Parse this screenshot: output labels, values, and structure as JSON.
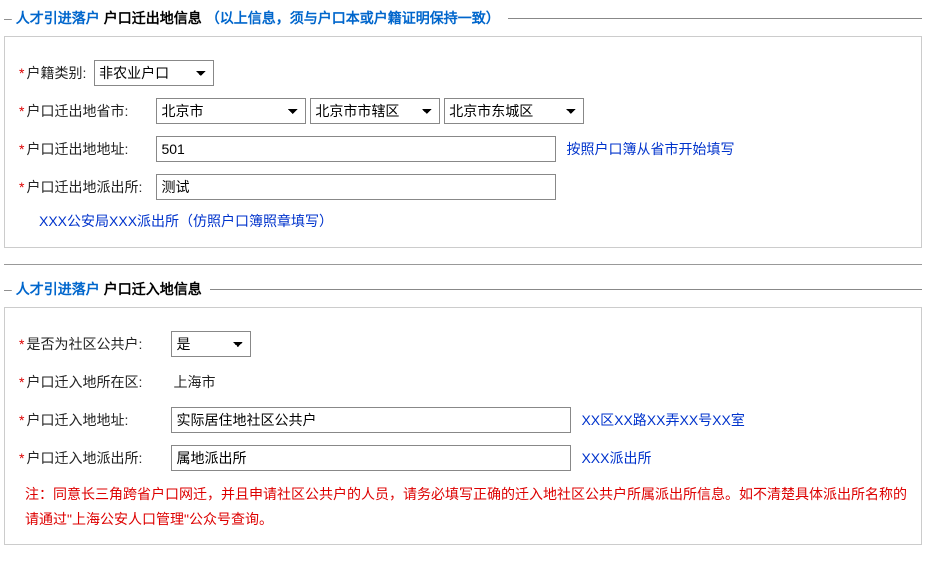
{
  "section1": {
    "title_blue": "人才引进落户",
    "title_black": "户口迁出地信息",
    "title_note": "（以上信息，须与户口本或户籍证明保持一致）",
    "hukou_type": {
      "label": "户籍类别:",
      "value": "非农业户口"
    },
    "province_row": {
      "label": "户口迁出地省市:",
      "province": "北京市",
      "city": "北京市市辖区",
      "district": "北京市东城区"
    },
    "addr": {
      "label": "户口迁出地地址:",
      "value": "501",
      "hint": "按照户口簿从省市开始填写"
    },
    "police": {
      "label": "户口迁出地派出所:",
      "value": "测试"
    },
    "police_hint": "XXX公安局XXX派出所（仿照户口簿照章填写）"
  },
  "section2": {
    "title_blue": "人才引进落户",
    "title_black": "户口迁入地信息",
    "community": {
      "label": "是否为社区公共户:",
      "value": "是"
    },
    "district_in": {
      "label": "户口迁入地所在区:",
      "value": "上海市"
    },
    "addr_in": {
      "label": "户口迁入地地址:",
      "value": "实际居住地社区公共户",
      "hint": "XX区XX路XX弄XX号XX室"
    },
    "police_in": {
      "label": "户口迁入地派出所:",
      "value": "属地派出所",
      "hint": "XXX派出所"
    },
    "note_red": "注：同意长三角跨省户口网迁，并且申请社区公共户的人员，请务必填写正确的迁入地社区公共户所属派出所信息。如不清楚具体派出所名称的请通过\"上海公安人口管理\"公众号查询。"
  }
}
